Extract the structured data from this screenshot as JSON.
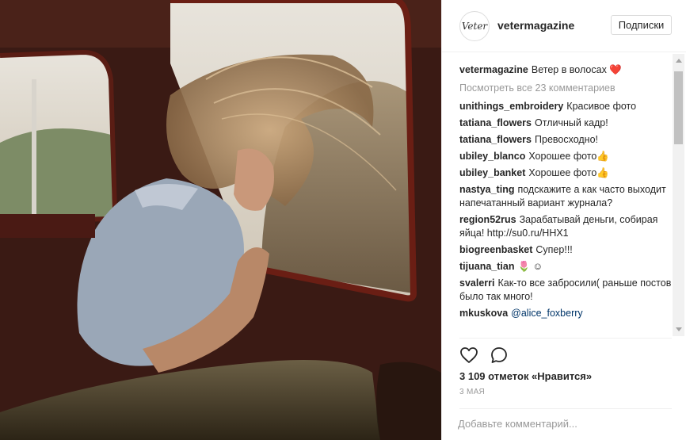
{
  "post": {
    "author": "vetermagazine",
    "avatar_text": "Veter",
    "follow_label": "Подписки",
    "caption": {
      "user": "vetermagazine",
      "text": "Ветер в волосах ❤️"
    },
    "view_all": "Посмотреть все 23 комментариев",
    "comments": [
      {
        "user": "unithings_embroidery",
        "text": "Красивое фото"
      },
      {
        "user": "tatiana_flowers",
        "text": "Отличный кадр!"
      },
      {
        "user": "tatiana_flowers",
        "text": "Превосходно!"
      },
      {
        "user": "ubiley_blanco",
        "text": "Хорошее фото👍"
      },
      {
        "user": "ubiley_banket",
        "text": "Хорошее фото👍"
      },
      {
        "user": "nastya_ting",
        "text": "подскажите а как часто выходит напечатанный вариант журнала?"
      },
      {
        "user": "region52rus",
        "text": "Зарабатывай деньги, собирая яйца! http://su0.ru/HHX1"
      },
      {
        "user": "biogreenbasket",
        "text": "Супер!!!"
      },
      {
        "user": "tijuana_tian",
        "text": "🌷 ☺"
      },
      {
        "user": "svalerri",
        "text": "Как-то все забросили( раньше постов было так много!"
      },
      {
        "user": "mkuskova",
        "text": "@alice_foxberry"
      }
    ],
    "likes": "3 109 отметок «Нравится»",
    "date": "3 МАЯ",
    "comment_placeholder": "Добавьте комментарий..."
  },
  "icons": {
    "like": "heart-outline-icon",
    "comment": "speech-bubble-icon"
  },
  "colors": {
    "text": "#262626",
    "muted": "#999999",
    "border": "#efefef",
    "link": "#003569",
    "heart": "#ed4956"
  }
}
